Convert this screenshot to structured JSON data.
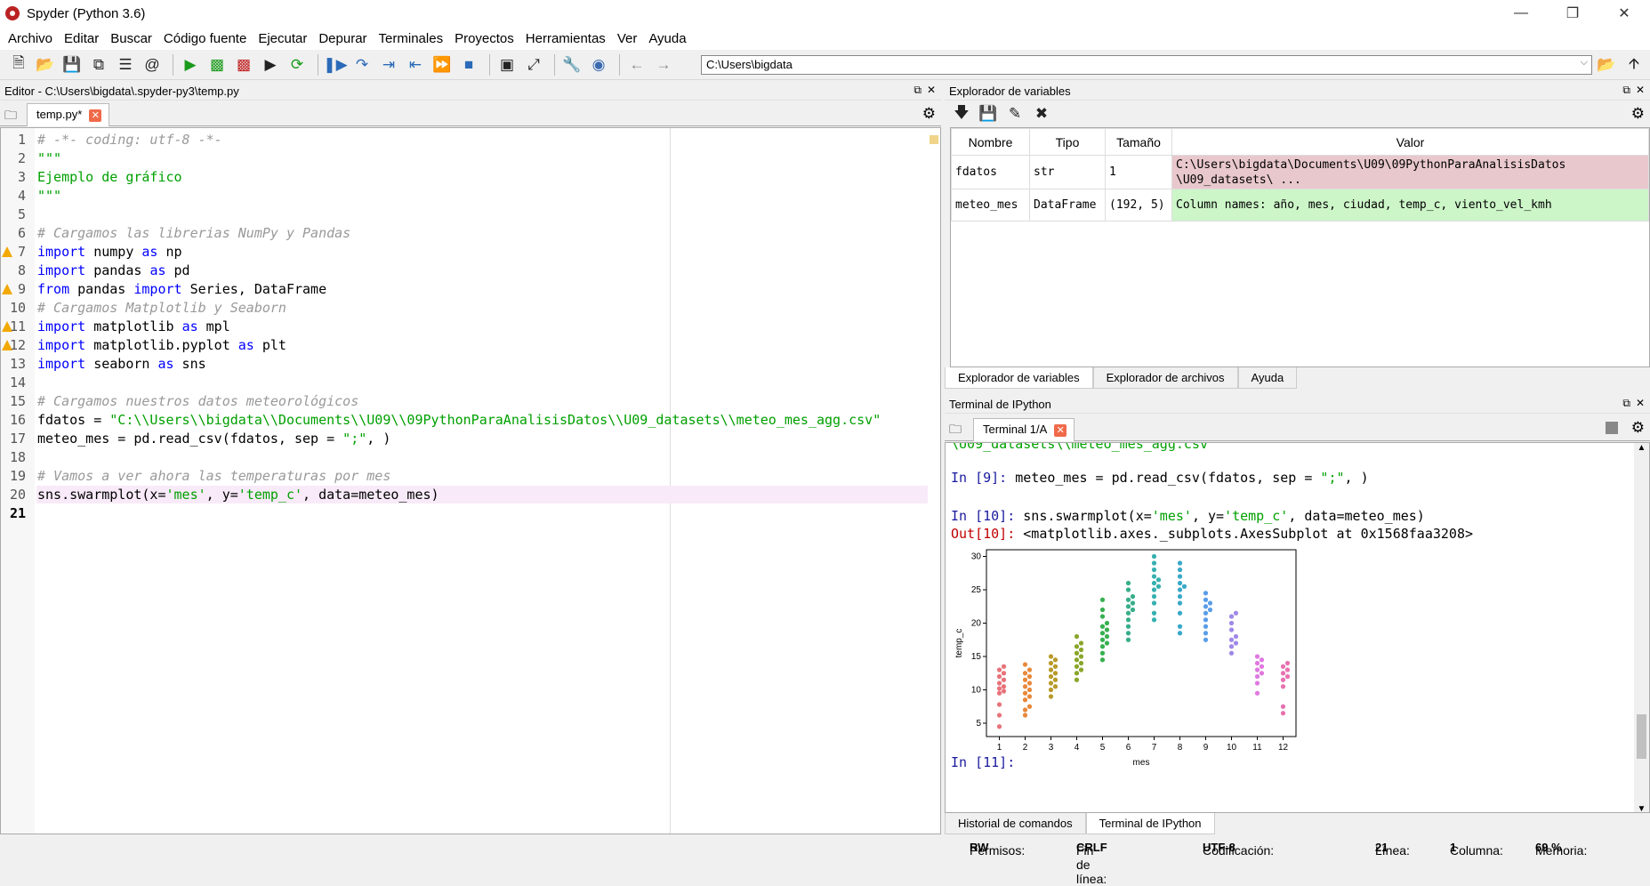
{
  "window": {
    "title": "Spyder (Python 3.6)"
  },
  "menu": [
    "Archivo",
    "Editar",
    "Buscar",
    "Código fuente",
    "Ejecutar",
    "Depurar",
    "Terminales",
    "Proyectos",
    "Herramientas",
    "Ver",
    "Ayuda"
  ],
  "toolbar": {
    "path": "C:\\Users\\bigdata"
  },
  "editor": {
    "title": "Editor - C:\\Users\\bigdata\\.spyder-py3\\temp.py",
    "tab": "temp.py*",
    "lines": [
      {
        "n": "1",
        "t": "# -*- coding: utf-8 -*-",
        "c": "cmt"
      },
      {
        "n": "2",
        "t": "\"\"\"",
        "c": "str"
      },
      {
        "n": "3",
        "t": "Ejemplo de gráfico",
        "c": "str"
      },
      {
        "n": "4",
        "t": "\"\"\"",
        "c": "str"
      },
      {
        "n": "5",
        "t": "",
        "c": ""
      },
      {
        "n": "6",
        "t": "# Cargamos las librerias NumPy y Pandas",
        "c": "cmt"
      },
      {
        "n": "7",
        "t": "import numpy as np",
        "c": "imp",
        "w": true
      },
      {
        "n": "8",
        "t": "import pandas as pd",
        "c": "imp"
      },
      {
        "n": "9",
        "t": "from pandas import Series, DataFrame",
        "c": "from",
        "w": true
      },
      {
        "n": "10",
        "t": "# Cargamos Matplotlib y Seaborn",
        "c": "cmt"
      },
      {
        "n": "11",
        "t": "import matplotlib as mpl",
        "c": "imp",
        "w": true
      },
      {
        "n": "12",
        "t": "import matplotlib.pyplot as plt",
        "c": "imp",
        "w": true
      },
      {
        "n": "13",
        "t": "import seaborn as sns",
        "c": "imp"
      },
      {
        "n": "14",
        "t": "",
        "c": ""
      },
      {
        "n": "15",
        "t": "# Cargamos nuestros datos meteorológicos",
        "c": "cmt"
      },
      {
        "n": "16",
        "t": "fdatos = \"C:\\\\Users\\\\bigdata\\\\Documents\\\\U09\\\\09PythonParaAnalisisDatos\\\\U09_datasets\\\\meteo_mes_agg.csv\"",
        "c": "assign"
      },
      {
        "n": "17",
        "t": "meteo_mes = pd.read_csv(fdatos, sep = \";\", )",
        "c": "readcsv"
      },
      {
        "n": "18",
        "t": "",
        "c": ""
      },
      {
        "n": "19",
        "t": "# Vamos a ver ahora las temperaturas por mes",
        "c": "cmt"
      },
      {
        "n": "20",
        "t": "sns.swarmplot(x='mes', y='temp_c', data=meteo_mes)",
        "c": "swarm"
      },
      {
        "n": "21",
        "t": "",
        "c": ""
      }
    ]
  },
  "varexplorer": {
    "title": "Explorador de variables",
    "headers": [
      "Nombre",
      "Tipo",
      "Tamaño",
      "Valor"
    ],
    "rows": [
      {
        "name": "fdatos",
        "type": "str",
        "size": "1",
        "value": "C:\\Users\\bigdata\\Documents\\U09\\09PythonParaAnalisisDatos\n\\U09_datasets\\ ...",
        "color": "#e8c8cc"
      },
      {
        "name": "meteo_mes",
        "type": "DataFrame",
        "size": "(192, 5)",
        "value": "Column names: año, mes, ciudad, temp_c, viento_vel_kmh",
        "color": "#ccf5c8"
      }
    ],
    "tabs": [
      "Explorador de variables",
      "Explorador de archivos",
      "Ayuda"
    ]
  },
  "terminal": {
    "title": "Terminal de IPython",
    "tab": "Terminal 1/A",
    "top_fragment": "\\U09_datasets\\\\meteo_mes_agg.csv'",
    "in9_prompt": "In [9]:",
    "in9_code": " meteo_mes = pd.read_csv(fdatos, sep = \";\", )",
    "in10_prompt": "In [10]:",
    "in10_code": " sns.swarmplot(x='mes', y='temp_c', data=meteo_mes)",
    "out10_prompt": "Out[10]:",
    "out10_text": " <matplotlib.axes._subplots.AxesSubplot at 0x1568faa3208>",
    "in11_prompt": "In [11]:",
    "tabs": [
      "Historial de comandos",
      "Terminal de IPython"
    ]
  },
  "status": {
    "permisos_label": "Permisos:",
    "permisos": "RW",
    "fin_label": "Fin de línea:",
    "fin": "CRLF",
    "cod_label": "Codificación:",
    "cod": "UTF-8",
    "linea_label": "Línea:",
    "linea": "21",
    "col_label": "Columna:",
    "col": "1",
    "mem_label": "Memoria:",
    "mem": "69 %"
  },
  "chart_data": {
    "type": "scatter",
    "xlabel": "mes",
    "ylabel": "temp_c",
    "categories": [
      "1",
      "2",
      "3",
      "4",
      "5",
      "6",
      "7",
      "8",
      "9",
      "10",
      "11",
      "12"
    ],
    "ylim": [
      3,
      31
    ],
    "yticks": [
      5,
      10,
      15,
      20,
      25,
      30
    ],
    "colors": [
      "#e8727a",
      "#e8883a",
      "#b89a2a",
      "#8aa62a",
      "#38b050",
      "#36ae8a",
      "#36b0b0",
      "#38a8c8",
      "#5a9ee8",
      "#a088e8",
      "#e078e0",
      "#e872b0"
    ],
    "series": [
      {
        "values": [
          4.5,
          6.2,
          7.8,
          9.5,
          9.8,
          10.2,
          10.5,
          11,
          11.5,
          12,
          12.5,
          13,
          13.5
        ]
      },
      {
        "values": [
          6.2,
          7,
          7.5,
          8.5,
          9,
          9.5,
          10,
          10.5,
          11,
          11.5,
          12,
          12.5,
          13,
          13.8
        ]
      },
      {
        "values": [
          9,
          10,
          10.5,
          11,
          11.5,
          12,
          12.5,
          13,
          13.5,
          14,
          14.5,
          15
        ]
      },
      {
        "values": [
          11.5,
          12.5,
          13,
          13.5,
          14,
          14.5,
          15,
          15.5,
          16,
          16.5,
          17,
          18
        ]
      },
      {
        "values": [
          14.5,
          15.5,
          16.5,
          17,
          17.5,
          18,
          18.5,
          19,
          19.5,
          20,
          21,
          22,
          23.5
        ]
      },
      {
        "values": [
          17.5,
          18.5,
          19.5,
          20.5,
          21.5,
          22,
          22.5,
          23,
          23.5,
          24,
          25,
          26
        ]
      },
      {
        "values": [
          20.5,
          21.5,
          23,
          24,
          25,
          25.5,
          26,
          26.5,
          27,
          28,
          29,
          30
        ]
      },
      {
        "values": [
          18.5,
          19.5,
          21.5,
          23,
          24,
          25,
          25.5,
          26,
          27,
          28,
          29
        ]
      },
      {
        "values": [
          17.5,
          18.5,
          19.5,
          20.5,
          21.5,
          22,
          22.5,
          23,
          23.5,
          24.5
        ]
      },
      {
        "values": [
          15.5,
          16.5,
          17,
          17.5,
          18,
          19,
          20,
          21,
          21.5
        ]
      },
      {
        "values": [
          9.5,
          11,
          12,
          12.5,
          13,
          13.5,
          14,
          14.5,
          15
        ]
      },
      {
        "values": [
          6.5,
          7.5,
          10.5,
          11.5,
          12,
          12.5,
          13,
          13.5,
          14
        ]
      }
    ]
  }
}
